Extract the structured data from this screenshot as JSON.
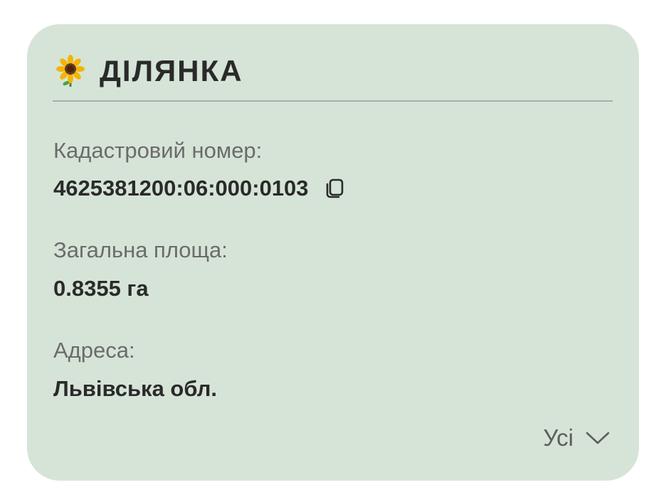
{
  "card": {
    "title": "ДІЛЯНКА",
    "icon": "sunflower-icon"
  },
  "fields": {
    "cadastral": {
      "label": "Кадастровий номер:",
      "value": "4625381200:06:000:0103",
      "action_icon": "copy-icon"
    },
    "area": {
      "label": "Загальна площа:",
      "value": "0.8355 га"
    },
    "address": {
      "label": "Адреса:",
      "value": "Львівська обл."
    }
  },
  "toggle": {
    "label": "Усі",
    "icon": "chevron-down-icon"
  },
  "colors": {
    "card_background": "#d6e4d7",
    "text_primary": "#2a2a2a",
    "text_secondary": "#6b6b6b"
  }
}
